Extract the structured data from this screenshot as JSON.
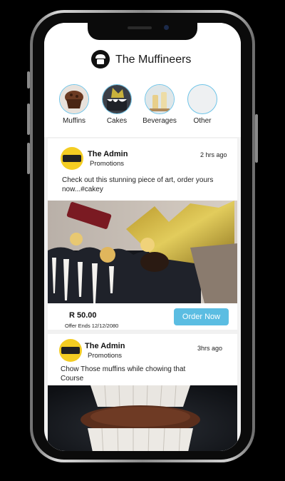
{
  "app": {
    "title": "The Muffineers",
    "logo_icon": "muffin-logo-icon"
  },
  "categories": [
    {
      "label": "Muffins",
      "icon": "muffins-thumbnail"
    },
    {
      "label": "Cakes",
      "icon": "cakes-thumbnail"
    },
    {
      "label": "Beverages",
      "icon": "beverages-thumbnail"
    },
    {
      "label": "Other",
      "icon": "other-thumbnail"
    }
  ],
  "posts": [
    {
      "author": "The Admin",
      "tag": "Promotions",
      "time": "2 hrs ago",
      "text": "Check out this stunning piece of art, order yours now...#cakey",
      "price": "R 50.00",
      "offer": "Offer Ends 12/12/2080",
      "cta": "Order Now"
    },
    {
      "author": "The Admin",
      "tag": "Promotions",
      "time": "3hrs ago",
      "text": "Chow Those muffins while chowing that Course"
    }
  ],
  "colors": {
    "accent": "#5bbde2",
    "avatar_yellow": "#f4cd22",
    "feed_background": "#f1f1f1"
  }
}
